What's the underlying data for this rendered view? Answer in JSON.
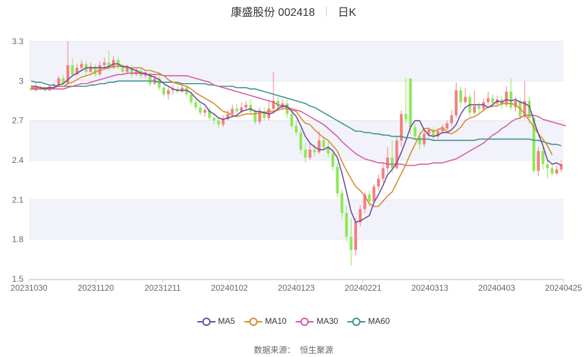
{
  "header": {
    "title": "康盛股份 002418",
    "period": "日K"
  },
  "source": {
    "label": "数据来源：",
    "provider": "恒生聚源"
  },
  "colors": {
    "up": "#f57f7f",
    "down": "#8ee85a",
    "MA5": "#6b4a9e",
    "MA10": "#d68b2e",
    "MA30": "#d45aa5",
    "MA60": "#3d918f",
    "band": "#f2f3fa",
    "grid": "#e6e6ee"
  },
  "chart_data": {
    "type": "candlestick",
    "title": "康盛股份 002418",
    "period": "日K",
    "ylim": [
      1.5,
      3.3
    ],
    "yticks": [
      "3.3",
      "3",
      "2.7",
      "2.4",
      "2.1",
      "1.8",
      "1.5"
    ],
    "xticks": [
      "20231030",
      "20231120",
      "20231211",
      "20240102",
      "20240123",
      "20240221",
      "20240313",
      "20240403",
      "20240425"
    ],
    "legend": [
      "MA5",
      "MA10",
      "MA30",
      "MA60"
    ],
    "legend_position": "bottom",
    "candles": [
      [
        2.95,
        2.93,
        2.97,
        2.93
      ],
      [
        2.93,
        2.95,
        2.98,
        2.92
      ],
      [
        2.95,
        2.94,
        2.97,
        2.93
      ],
      [
        2.94,
        2.93,
        2.96,
        2.92
      ],
      [
        2.93,
        2.96,
        2.97,
        2.92
      ],
      [
        2.96,
        2.97,
        2.99,
        2.95
      ],
      [
        2.97,
        3.02,
        3.04,
        2.96
      ],
      [
        3.02,
        2.98,
        3.05,
        2.97
      ],
      [
        2.98,
        3.12,
        3.3,
        2.97
      ],
      [
        3.12,
        3.05,
        3.17,
        3.03
      ],
      [
        3.05,
        3.1,
        3.13,
        3.04
      ],
      [
        3.1,
        3.13,
        3.16,
        3.08
      ],
      [
        3.13,
        3.07,
        3.15,
        3.05
      ],
      [
        3.07,
        3.11,
        3.14,
        3.06
      ],
      [
        3.11,
        3.05,
        3.13,
        3.03
      ],
      [
        3.05,
        3.12,
        3.15,
        3.04
      ],
      [
        3.12,
        3.14,
        3.18,
        3.1
      ],
      [
        3.14,
        3.1,
        3.23,
        3.08
      ],
      [
        3.1,
        3.16,
        3.19,
        3.09
      ],
      [
        3.16,
        3.11,
        3.18,
        3.09
      ],
      [
        3.11,
        3.07,
        3.13,
        3.05
      ],
      [
        3.07,
        3.1,
        3.12,
        3.05
      ],
      [
        3.1,
        3.05,
        3.12,
        3.03
      ],
      [
        3.05,
        3.08,
        3.1,
        3.04
      ],
      [
        3.08,
        3.04,
        3.1,
        3.02
      ],
      [
        3.04,
        3.05,
        3.08,
        3.02
      ],
      [
        3.05,
        2.98,
        3.07,
        2.96
      ],
      [
        2.98,
        3.02,
        3.04,
        2.97
      ],
      [
        3.02,
        2.95,
        3.04,
        2.93
      ],
      [
        2.95,
        2.9,
        2.97,
        2.88
      ],
      [
        2.9,
        2.93,
        2.95,
        2.86
      ],
      [
        2.93,
        2.94,
        2.97,
        2.9
      ],
      [
        2.94,
        2.92,
        2.96,
        2.9
      ],
      [
        2.92,
        2.95,
        2.98,
        2.91
      ],
      [
        2.95,
        2.9,
        2.97,
        2.88
      ],
      [
        2.9,
        2.84,
        2.92,
        2.82
      ],
      [
        2.84,
        2.8,
        2.86,
        2.78
      ],
      [
        2.8,
        2.76,
        2.83,
        2.74
      ],
      [
        2.76,
        2.78,
        2.8,
        2.73
      ],
      [
        2.78,
        2.72,
        2.8,
        2.7
      ],
      [
        2.72,
        2.7,
        2.75,
        2.67
      ],
      [
        2.7,
        2.67,
        2.73,
        2.64
      ],
      [
        2.67,
        2.71,
        2.74,
        2.65
      ],
      [
        2.71,
        2.75,
        2.78,
        2.7
      ],
      [
        2.75,
        2.79,
        2.82,
        2.73
      ],
      [
        2.79,
        2.77,
        2.83,
        2.75
      ],
      [
        2.77,
        2.8,
        2.84,
        2.75
      ],
      [
        2.8,
        2.82,
        2.85,
        2.78
      ],
      [
        2.82,
        2.77,
        2.86,
        2.75
      ],
      [
        2.77,
        2.69,
        2.79,
        2.67
      ],
      [
        2.69,
        2.77,
        2.8,
        2.67
      ],
      [
        2.77,
        2.72,
        2.8,
        2.7
      ],
      [
        2.72,
        2.79,
        2.86,
        2.7
      ],
      [
        2.79,
        2.85,
        3.07,
        2.77
      ],
      [
        2.85,
        2.8,
        2.88,
        2.78
      ],
      [
        2.8,
        2.83,
        2.86,
        2.78
      ],
      [
        2.83,
        2.75,
        2.86,
        2.72
      ],
      [
        2.75,
        2.66,
        2.78,
        2.64
      ],
      [
        2.66,
        2.61,
        2.7,
        2.58
      ],
      [
        2.61,
        2.48,
        2.64,
        2.45
      ],
      [
        2.48,
        2.42,
        2.53,
        2.38
      ],
      [
        2.42,
        2.48,
        2.53,
        2.4
      ],
      [
        2.48,
        2.46,
        2.52,
        2.43
      ],
      [
        2.46,
        2.55,
        2.62,
        2.45
      ],
      [
        2.55,
        2.5,
        2.58,
        2.47
      ],
      [
        2.5,
        2.45,
        2.55,
        2.42
      ],
      [
        2.45,
        2.35,
        2.48,
        2.32
      ],
      [
        2.35,
        2.15,
        2.38,
        2.12
      ],
      [
        2.15,
        2.0,
        2.18,
        1.95
      ],
      [
        2.0,
        1.82,
        2.05,
        1.78
      ],
      [
        1.82,
        1.72,
        1.96,
        1.6
      ],
      [
        1.72,
        1.93,
        1.96,
        1.68
      ],
      [
        1.93,
        2.03,
        2.06,
        1.9
      ],
      [
        2.03,
        2.14,
        2.16,
        2.0
      ],
      [
        2.14,
        2.09,
        2.17,
        2.05
      ],
      [
        2.09,
        2.2,
        2.22,
        2.07
      ],
      [
        2.2,
        2.26,
        2.29,
        2.17
      ],
      [
        2.26,
        2.34,
        2.38,
        2.23
      ],
      [
        2.34,
        2.42,
        2.5,
        2.31
      ],
      [
        2.42,
        2.34,
        2.55,
        2.3
      ],
      [
        2.34,
        2.55,
        2.58,
        2.33
      ],
      [
        2.55,
        2.75,
        2.78,
        2.5
      ],
      [
        2.75,
        2.71,
        3.02,
        2.68
      ],
      [
        3.02,
        2.65,
        3.02,
        2.6
      ],
      [
        2.65,
        2.58,
        2.68,
        2.55
      ],
      [
        2.58,
        2.52,
        2.62,
        2.48
      ],
      [
        2.52,
        2.6,
        2.63,
        2.5
      ],
      [
        2.6,
        2.63,
        2.65,
        2.57
      ],
      [
        2.63,
        2.58,
        2.65,
        2.55
      ],
      [
        2.58,
        2.62,
        2.64,
        2.56
      ],
      [
        2.62,
        2.64,
        2.67,
        2.6
      ],
      [
        2.64,
        2.68,
        2.7,
        2.62
      ],
      [
        2.68,
        2.74,
        2.78,
        2.66
      ],
      [
        2.74,
        2.93,
        2.99,
        2.72
      ],
      [
        2.93,
        2.84,
        2.96,
        2.8
      ],
      [
        2.84,
        2.88,
        2.95,
        2.82
      ],
      [
        2.88,
        2.76,
        2.9,
        2.73
      ],
      [
        2.76,
        2.81,
        2.93,
        2.74
      ],
      [
        2.81,
        2.79,
        2.84,
        2.76
      ],
      [
        2.79,
        2.84,
        2.87,
        2.77
      ],
      [
        2.84,
        2.87,
        2.92,
        2.82
      ],
      [
        2.87,
        2.83,
        2.9,
        2.8
      ],
      [
        2.83,
        2.86,
        2.89,
        2.81
      ],
      [
        2.86,
        2.82,
        2.88,
        2.79
      ],
      [
        2.82,
        2.92,
        2.96,
        2.8
      ],
      [
        2.92,
        2.8,
        3.02,
        2.78
      ],
      [
        2.8,
        2.85,
        2.88,
        2.77
      ],
      [
        2.85,
        2.73,
        2.87,
        2.7
      ],
      [
        2.73,
        2.85,
        3.0,
        2.71
      ],
      [
        2.85,
        2.72,
        2.88,
        2.68
      ],
      [
        2.72,
        2.32,
        2.75,
        2.3
      ],
      [
        2.32,
        2.47,
        2.5,
        2.28
      ],
      [
        2.47,
        2.37,
        2.5,
        2.33
      ],
      [
        2.37,
        2.34,
        2.4,
        2.26
      ],
      [
        2.34,
        2.3,
        2.37,
        2.28
      ],
      [
        2.3,
        2.33,
        2.36,
        2.29
      ],
      [
        2.33,
        2.37,
        2.4,
        2.31
      ]
    ],
    "MA5": [
      2.96,
      2.96,
      2.95,
      2.94,
      2.95,
      2.95,
      2.97,
      2.98,
      3.01,
      3.04,
      3.06,
      3.08,
      3.1,
      3.1,
      3.1,
      3.1,
      3.1,
      3.11,
      3.13,
      3.13,
      3.11,
      3.11,
      3.09,
      3.08,
      3.06,
      3.06,
      3.04,
      3.03,
      3.01,
      2.98,
      2.96,
      2.94,
      2.93,
      2.93,
      2.93,
      2.91,
      2.87,
      2.84,
      2.82,
      2.77,
      2.75,
      2.72,
      2.71,
      2.72,
      2.73,
      2.74,
      2.77,
      2.78,
      2.79,
      2.77,
      2.77,
      2.76,
      2.75,
      2.76,
      2.79,
      2.81,
      2.81,
      2.77,
      2.73,
      2.66,
      2.58,
      2.53,
      2.5,
      2.48,
      2.48,
      2.5,
      2.47,
      2.42,
      2.3,
      2.16,
      2.01,
      1.93,
      1.94,
      1.96,
      1.98,
      2.08,
      2.14,
      2.21,
      2.29,
      2.33,
      2.38,
      2.46,
      2.55,
      2.65,
      2.7,
      2.7,
      2.63,
      2.59,
      2.58,
      2.59,
      2.61,
      2.61,
      2.63,
      2.67,
      2.75,
      2.8,
      2.82,
      2.82,
      2.82,
      2.82,
      2.8,
      2.82,
      2.85,
      2.84,
      2.86,
      2.85,
      2.86,
      2.84,
      2.83,
      2.81,
      2.7,
      2.6,
      2.51,
      2.4,
      2.37,
      2.38,
      2.36
    ],
    "MA10": [
      2.95,
      2.95,
      2.95,
      2.95,
      2.95,
      2.95,
      2.96,
      2.96,
      2.98,
      2.99,
      3.01,
      3.03,
      3.04,
      3.05,
      3.07,
      3.08,
      3.09,
      3.1,
      3.11,
      3.11,
      3.11,
      3.1,
      3.1,
      3.1,
      3.1,
      3.08,
      3.08,
      3.07,
      3.06,
      3.04,
      3.01,
      2.99,
      2.98,
      2.97,
      2.96,
      2.94,
      2.91,
      2.89,
      2.87,
      2.85,
      2.83,
      2.8,
      2.77,
      2.76,
      2.74,
      2.73,
      2.74,
      2.75,
      2.75,
      2.75,
      2.76,
      2.76,
      2.77,
      2.77,
      2.78,
      2.79,
      2.79,
      2.78,
      2.77,
      2.72,
      2.68,
      2.67,
      2.63,
      2.6,
      2.57,
      2.55,
      2.51,
      2.47,
      2.39,
      2.32,
      2.26,
      2.2,
      2.17,
      2.13,
      2.07,
      2.05,
      2.05,
      2.09,
      2.13,
      2.16,
      2.23,
      2.3,
      2.37,
      2.45,
      2.52,
      2.59,
      2.64,
      2.64,
      2.62,
      2.63,
      2.65,
      2.61,
      2.6,
      2.62,
      2.65,
      2.7,
      2.72,
      2.73,
      2.75,
      2.78,
      2.8,
      2.81,
      2.81,
      2.83,
      2.83,
      2.83,
      2.82,
      2.79,
      2.75,
      2.7,
      2.65,
      2.6,
      2.56,
      2.51,
      2.44
    ],
    "MA30": [
      2.94,
      2.94,
      2.94,
      2.94,
      2.94,
      2.94,
      2.94,
      2.94,
      2.95,
      2.96,
      2.97,
      2.98,
      2.98,
      2.99,
      3.0,
      3.01,
      3.02,
      3.03,
      3.04,
      3.05,
      3.05,
      3.06,
      3.06,
      3.06,
      3.06,
      3.05,
      3.05,
      3.05,
      3.05,
      3.04,
      3.04,
      3.04,
      3.04,
      3.04,
      3.04,
      3.03,
      3.02,
      3.01,
      3.0,
      2.99,
      2.97,
      2.96,
      2.95,
      2.94,
      2.93,
      2.92,
      2.91,
      2.9,
      2.89,
      2.88,
      2.87,
      2.86,
      2.85,
      2.84,
      2.82,
      2.81,
      2.8,
      2.79,
      2.78,
      2.77,
      2.75,
      2.73,
      2.71,
      2.69,
      2.67,
      2.64,
      2.61,
      2.58,
      2.54,
      2.51,
      2.48,
      2.45,
      2.43,
      2.41,
      2.4,
      2.39,
      2.38,
      2.38,
      2.37,
      2.37,
      2.37,
      2.37,
      2.36,
      2.36,
      2.36,
      2.37,
      2.37,
      2.37,
      2.38,
      2.38,
      2.38,
      2.39,
      2.4,
      2.41,
      2.43,
      2.45,
      2.47,
      2.49,
      2.51,
      2.53,
      2.56,
      2.59,
      2.61,
      2.64,
      2.66,
      2.69,
      2.71,
      2.72,
      2.74,
      2.74,
      2.74,
      2.73,
      2.71,
      2.7,
      2.69,
      2.68,
      2.67,
      2.66
    ],
    "MA60": [
      3.0,
      2.99,
      2.99,
      2.98,
      2.97,
      2.97,
      2.96,
      2.96,
      2.96,
      2.96,
      2.96,
      2.96,
      2.96,
      2.97,
      2.97,
      2.98,
      2.98,
      2.99,
      2.99,
      3.0,
      3.0,
      3.0,
      3.0,
      3.0,
      3.0,
      3.0,
      3.0,
      3.0,
      2.99,
      2.99,
      2.99,
      2.99,
      2.99,
      2.98,
      2.98,
      2.98,
      2.98,
      2.98,
      2.98,
      2.97,
      2.97,
      2.96,
      2.96,
      2.96,
      2.96,
      2.95,
      2.95,
      2.95,
      2.94,
      2.94,
      2.93,
      2.92,
      2.91,
      2.9,
      2.89,
      2.88,
      2.87,
      2.86,
      2.85,
      2.84,
      2.83,
      2.81,
      2.8,
      2.78,
      2.76,
      2.74,
      2.72,
      2.7,
      2.68,
      2.66,
      2.64,
      2.62,
      2.62,
      2.61,
      2.61,
      2.6,
      2.6,
      2.59,
      2.59,
      2.58,
      2.58,
      2.58,
      2.57,
      2.57,
      2.56,
      2.56,
      2.56,
      2.56,
      2.55,
      2.55,
      2.55,
      2.55,
      2.55,
      2.55,
      2.55,
      2.55,
      2.55,
      2.55,
      2.56,
      2.56,
      2.56,
      2.56,
      2.56,
      2.56,
      2.56,
      2.56,
      2.56,
      2.56,
      2.56,
      2.56,
      2.55,
      2.55,
      2.54,
      2.53,
      2.52,
      2.52,
      2.51
    ]
  }
}
